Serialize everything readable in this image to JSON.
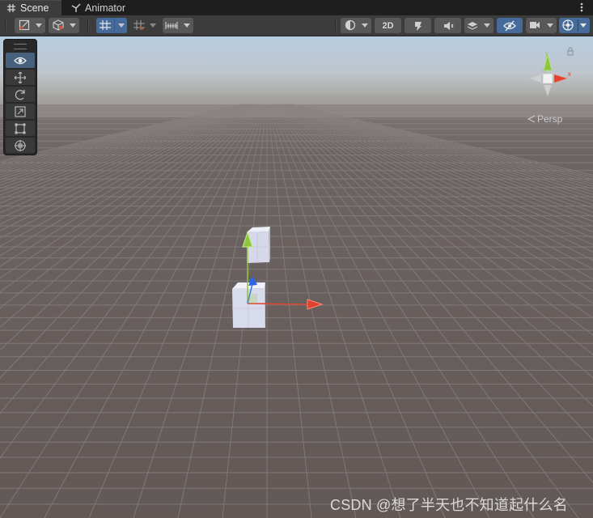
{
  "tabs": [
    {
      "label": "Scene",
      "icon": "grid-icon",
      "active": true
    },
    {
      "label": "Animator",
      "icon": "animator-icon",
      "active": false
    }
  ],
  "tab_menu_icon": "more-vert-icon",
  "toolbar": {
    "left_buttons": [
      "draw-mode-icon",
      "render-mode-cube-icon",
      "grid-snap-icon",
      "increment-snap-icon",
      "ruler-icon"
    ],
    "right_buttons": {
      "shading_icon": "shading-sphere-icon",
      "two_d_label": "2D",
      "lighting_icon": "lighting-icon",
      "audio_icon": "audio-icon",
      "effects_icon": "effects-layers-icon",
      "hidden_icon": "visibility-off-icon",
      "camera_icon": "camera-icon",
      "gizmos_icon": "gizmos-globe-icon"
    },
    "accent_color": "#466a9a"
  },
  "tools": [
    "view-tool-eye-icon",
    "move-tool-icon",
    "rotate-tool-icon",
    "scale-tool-icon",
    "rect-tool-icon",
    "transform-tool-icon"
  ],
  "selected_tool": "view-tool-eye-icon",
  "scene_gizmo": {
    "projection_label": "Persp",
    "axis_colors": {
      "x": "#e0422e",
      "y": "#8ec63b",
      "z": "#3a6fd8"
    }
  },
  "watermark": "CSDN @想了半天也不知道起什么名"
}
